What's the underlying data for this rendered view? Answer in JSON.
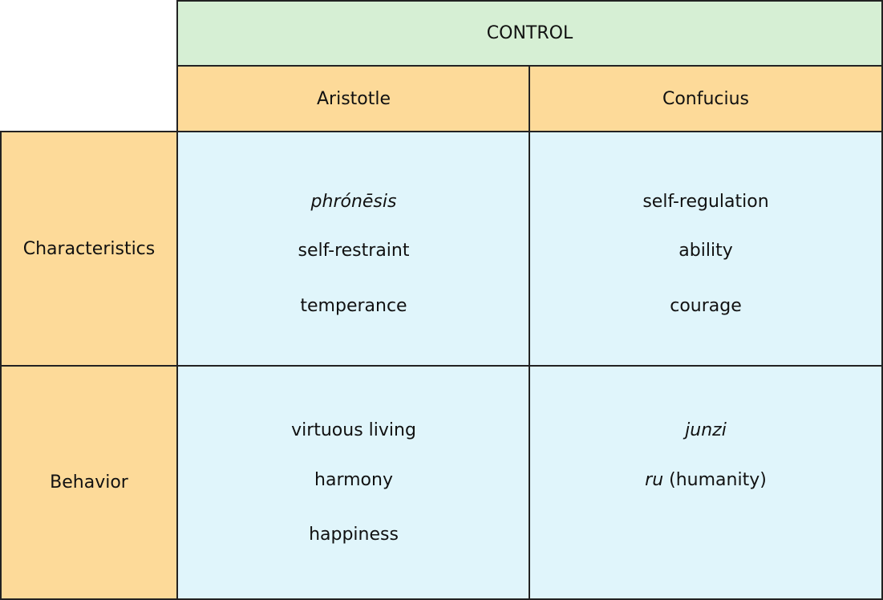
{
  "header": {
    "title": "CONTROL"
  },
  "columns": [
    {
      "label": "Aristotle"
    },
    {
      "label": "Confucius"
    }
  ],
  "rows": [
    {
      "label": "Characteristics",
      "cells": [
        {
          "items": [
            {
              "text": "phrónēsis",
              "italic": true
            },
            {
              "text": "self-restraint"
            },
            {
              "text": "temperance"
            }
          ]
        },
        {
          "items": [
            {
              "text": "self-regulation"
            },
            {
              "text": "ability"
            },
            {
              "text": "courage"
            }
          ]
        }
      ]
    },
    {
      "label": "Behavior",
      "cells": [
        {
          "items": [
            {
              "text": "virtuous living"
            },
            {
              "text": "harmony"
            },
            {
              "text": "happiness"
            }
          ]
        },
        {
          "items": [
            {
              "text": "junzi",
              "italic": true
            },
            {
              "italic_part": "ru",
              "text": " (humanity)"
            }
          ]
        }
      ]
    }
  ],
  "colors": {
    "header_green": "#d6efd4",
    "label_orange": "#fdda99",
    "cell_blue": "#e0f5fb",
    "border": "#222222"
  }
}
